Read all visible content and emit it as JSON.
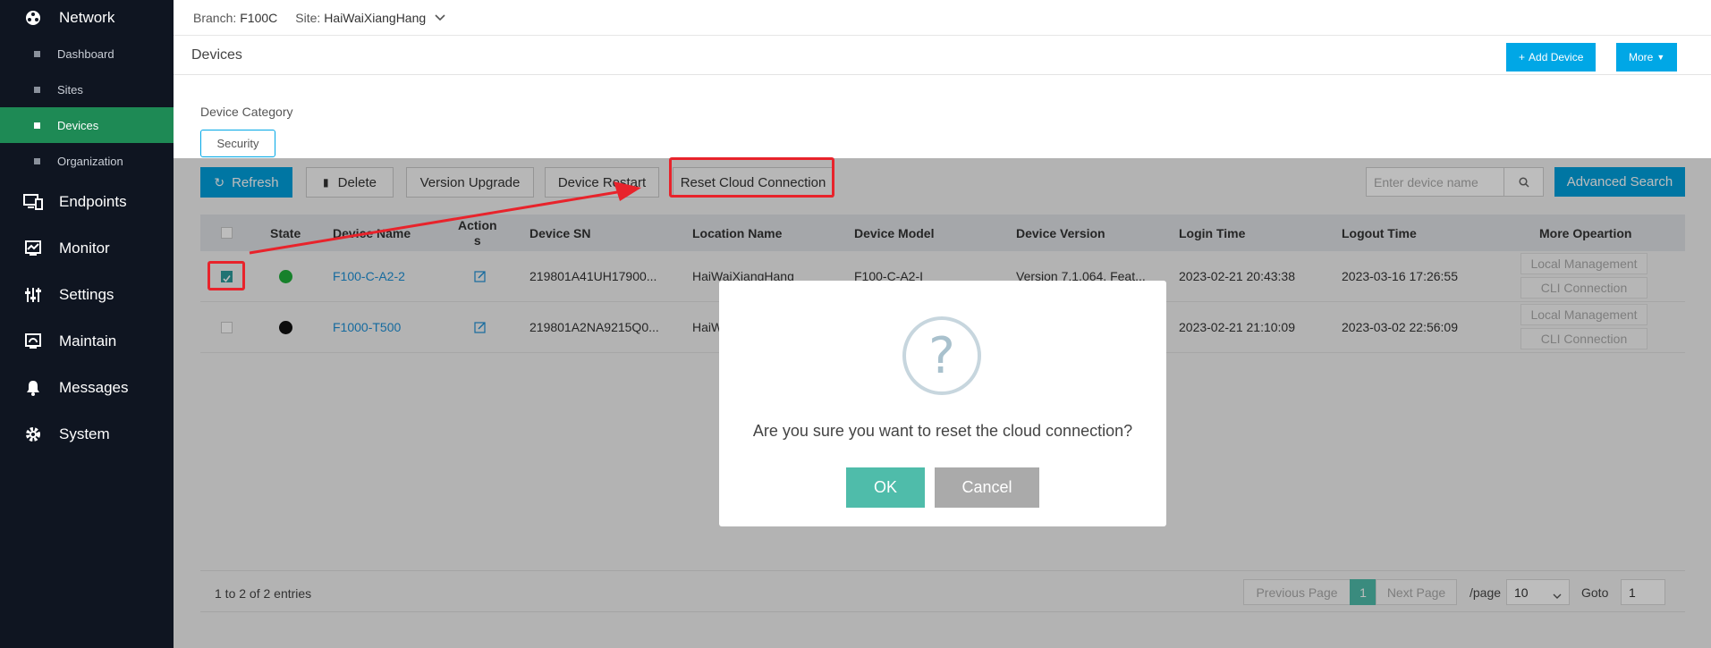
{
  "sidebar": {
    "network": "Network",
    "sub": [
      "Dashboard",
      "Sites",
      "Devices",
      "Organization"
    ],
    "groups": [
      "Endpoints",
      "Monitor",
      "Settings",
      "Maintain",
      "Messages",
      "System"
    ]
  },
  "topbar": {
    "branch_label": "Branch:",
    "branch_value": "F100C",
    "site_label": "Site:",
    "site_value": "HaiWaiXiangHang"
  },
  "page": {
    "title": "Devices",
    "add_device": "Add Device",
    "more": "More"
  },
  "category": {
    "label": "Device Category",
    "tab": "Security"
  },
  "toolbar": {
    "refresh": "Refresh",
    "delete": "Delete",
    "version_upgrade": "Version Upgrade",
    "device_restart": "Device Restart",
    "reset_cloud": "Reset Cloud Connection",
    "search_placeholder": "Enter device name",
    "advanced_search": "Advanced Search"
  },
  "table": {
    "headers": [
      "State",
      "Device Name",
      "Action\ns",
      "Device SN",
      "Location Name",
      "Device Model",
      "Device Version",
      "Login Time",
      "Logout Time",
      "More Opeartion"
    ],
    "rows": [
      {
        "checked": true,
        "state_color": "#1fae3a",
        "name": "F100-C-A2-2",
        "sn": "219801A41UH17900...",
        "location": "HaiWaiXiangHang",
        "model": "F100-C-A2-I",
        "version": "Version 7.1.064, Feat...",
        "login": "2023-02-21 20:43:38",
        "logout": "2023-03-16 17:26:55"
      },
      {
        "checked": false,
        "state_color": "#111111",
        "name": "F1000-T500",
        "sn": "219801A2NA9215Q0...",
        "location": "HaiW",
        "model": "",
        "version": "",
        "login": "2023-02-21 21:10:09",
        "logout": "2023-03-02 22:56:09"
      }
    ],
    "op_local": "Local Management",
    "op_cli": "CLI Connection"
  },
  "footer": {
    "entries": "1 to 2 of 2 entries",
    "prev": "Previous Page",
    "page": "1",
    "next": "Next Page",
    "per_page_label": "/page",
    "per_page": "10",
    "goto_label": "Goto",
    "goto_value": "1"
  },
  "dialog": {
    "icon": "?",
    "message": "Are you sure you want to reset the cloud connection?",
    "ok": "OK",
    "cancel": "Cancel"
  },
  "colors": {
    "accent": "#00a7e6",
    "ok": "#4fbcaa",
    "sidebar_active": "#1e8a55",
    "annotation": "#e8232b"
  }
}
